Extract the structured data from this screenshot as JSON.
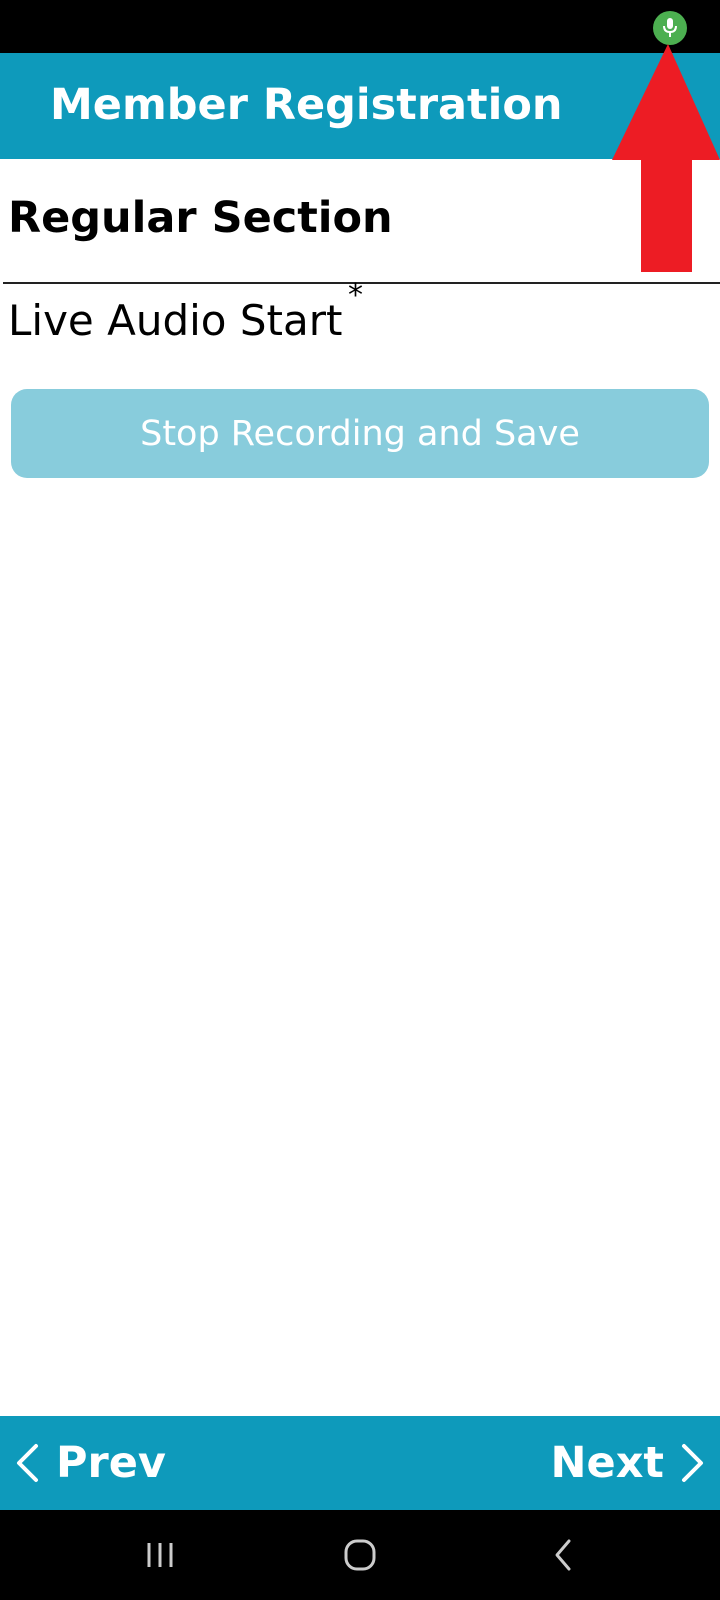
{
  "status_bar": {
    "mic_icon": "mic-icon",
    "mic_color": "#4caf50"
  },
  "header": {
    "title": "Member Registration",
    "bg_color": "#0e9abb"
  },
  "form": {
    "section_title": "Regular Section",
    "question_label": "Live Audio Start",
    "required_marker": "*",
    "stop_button_label": "Stop Recording and Save"
  },
  "footer": {
    "prev_label": "Prev",
    "next_label": "Next"
  },
  "system_nav": {
    "recents_icon": "recents-icon",
    "home_icon": "home-icon",
    "back_icon": "back-icon"
  },
  "annotation": {
    "arrow_color": "#ed1c24"
  }
}
